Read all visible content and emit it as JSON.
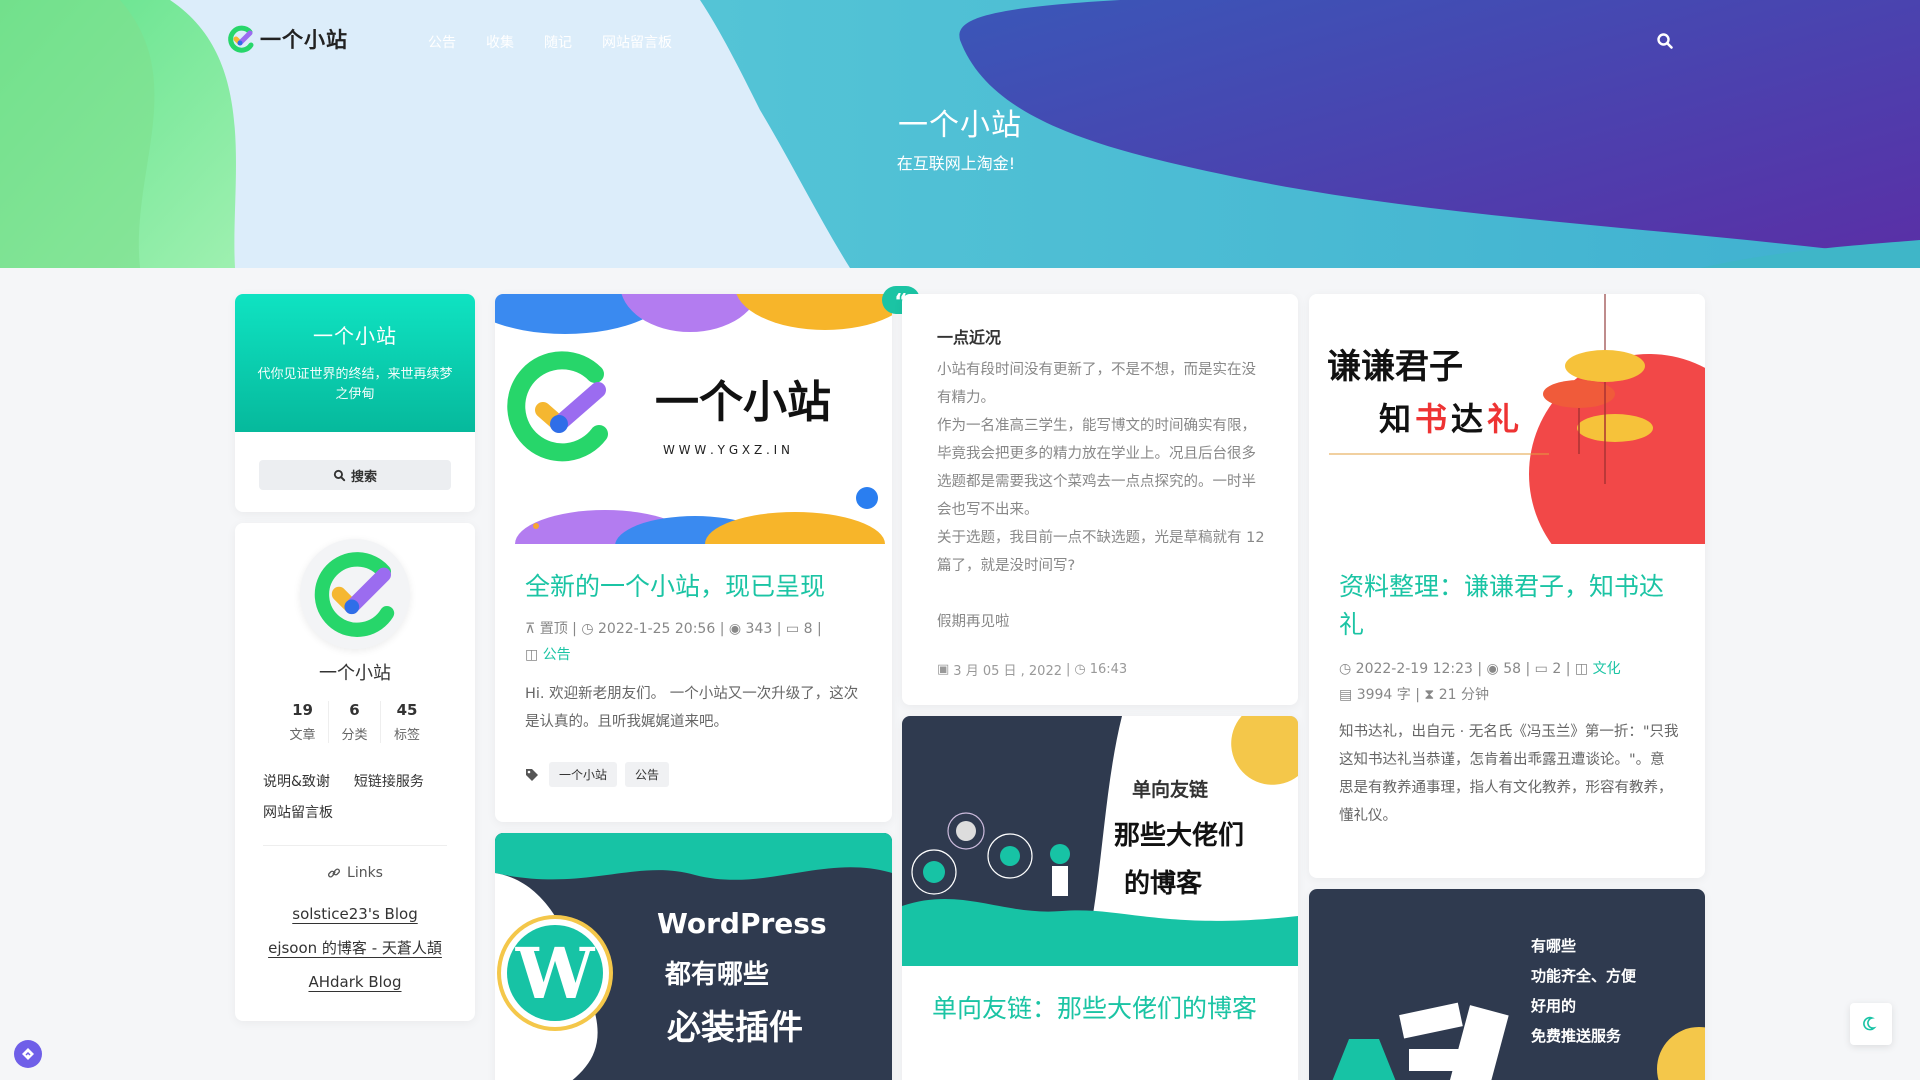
{
  "header": {
    "logo_text": "一个小站",
    "nav": [
      "公告",
      "收集",
      "随记",
      "网站留言板"
    ],
    "hero_title": "一个小站",
    "hero_subtitle": "在互联网上淘金!"
  },
  "sidebar": {
    "card_title": "一个小站",
    "card_desc": "代你见证世界的终结，来世再续梦之伊甸",
    "search_label": "搜索",
    "profile_name": "一个小站",
    "stats": [
      {
        "value": "19",
        "label": "文章"
      },
      {
        "value": "6",
        "label": "分类"
      },
      {
        "value": "45",
        "label": "标签"
      }
    ],
    "page_links": [
      "说明&致谢",
      "短链接服务",
      "网站留言板"
    ],
    "links_heading": "Links",
    "friend_links": [
      "solstice23's Blog",
      "ejsoon 的博客 - 天蒼人頡",
      "AHdark Blog"
    ]
  },
  "posts": {
    "p1": {
      "banner_text": "一个小站",
      "banner_url": "W W W . Y G X Z . I N",
      "title": "全新的一个小站，现已呈现",
      "pinned": "置顶",
      "date": "2022-1-25 20:56",
      "views": "343",
      "comments": "8",
      "category": "公告",
      "excerpt": "Hi. 欢迎新老朋友们。 一个小站又一次升级了，这次是认真的。且听我娓娓道来吧。",
      "tags": [
        "一个小站",
        "公告"
      ]
    },
    "p2": {
      "heading": "一点近况",
      "paragraphs": [
        "小站有段时间没有更新了，不是不想，而是实在没有精力。",
        "作为一名准高三学生，能写博文的时间确实有限，毕竟我会把更多的精力放在学业上。况且后台很多选题都是需要我这个菜鸡去一点点探究的。一时半会也写不出来。",
        "关于选题，我目前一点不缺选题，光是草稿就有 12 篇了，就是没时间写?",
        "",
        "假期再见啦"
      ],
      "date": "3 月 05 日 , 2022",
      "time": "16:43"
    },
    "p3": {
      "banner_line1": "谦谦君子",
      "banner_line2a": "知",
      "banner_line2b": "书",
      "banner_line2c": "达",
      "banner_line2d": "礼",
      "title": "资料整理：谦谦君子，知书达礼",
      "date": "2022-2-19 12:23",
      "views": "58",
      "comments": "2",
      "category": "文化",
      "words": "3994 字",
      "read_time": "21 分钟",
      "excerpt": "知书达礼，出自元 · 无名氏《冯玉兰》第一折：\"只我这知书达礼当恭谨，怎肯着出乖露丑遭谈论。\"。意思是有教养通事理，指人有文化教养，形容有教养，懂礼仪。"
    },
    "p4": {
      "banner_line1": "WordPress",
      "banner_line2": "都有哪些",
      "banner_line3": "必装插件"
    },
    "p5": {
      "banner_line1": "单向友链",
      "banner_line2": "那些大佬们",
      "banner_line3": "的博客",
      "title": "单向友链：那些大佬们的博客"
    },
    "p6": {
      "banner_line1": "有哪些",
      "banner_line2": "功能齐全、方便",
      "banner_line3": "好用的",
      "banner_line4": "免费推送服务"
    }
  },
  "colors": {
    "accent": "#1bc4a4",
    "hero_purple": "#4b34a8",
    "hero_teal": "#3fc4c8",
    "hero_green": "#7ee89a"
  }
}
